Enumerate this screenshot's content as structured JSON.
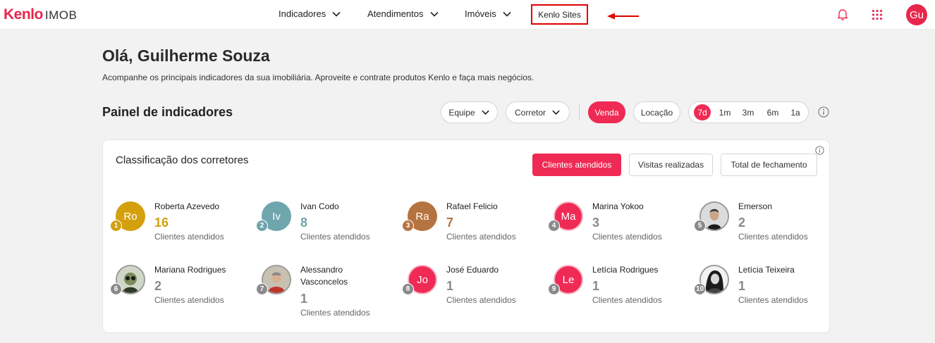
{
  "header": {
    "logo_brand": "Kenlo",
    "logo_product": "IMOB",
    "nav": [
      {
        "label": "Indicadores"
      },
      {
        "label": "Atendimentos"
      },
      {
        "label": "Imóveis"
      },
      {
        "label": "Kenlo Sites"
      }
    ],
    "user_initials": "Gu",
    "icons": [
      "bell-icon",
      "apps-grid-icon"
    ]
  },
  "greeting": "Olá, Guilherme Souza",
  "subtitle": "Acompanhe os principais indicadores da sua imobiliária. Aproveite e contrate produtos Kenlo e faça mais negócios.",
  "panel": {
    "title": "Painel de indicadores",
    "filters": {
      "team": "Equipe",
      "broker": "Corretor"
    },
    "deal_types": [
      "Venda",
      "Locação"
    ],
    "deal_type_selected": "Venda",
    "periods": [
      "7d",
      "1m",
      "3m",
      "6m",
      "1a"
    ],
    "period_selected": "7d"
  },
  "ranking": {
    "title": "Classificação dos corretores",
    "tabs": [
      "Clientes atendidos",
      "Visitas realizadas",
      "Total de fechamento"
    ],
    "tab_selected": "Clientes atendidos",
    "metric_label": "Clientes atendidos",
    "brokers": [
      {
        "rank": "1",
        "name": "Roberta Azevedo",
        "initials": "Ro",
        "count": "16",
        "color": "#d4a00e"
      },
      {
        "rank": "2",
        "name": "Ivan Codo",
        "initials": "Iv",
        "count": "8",
        "color": "#6fa6ad"
      },
      {
        "rank": "3",
        "name": "Rafael Felicio",
        "initials": "Ra",
        "count": "7",
        "color": "#b5733f"
      },
      {
        "rank": "4",
        "name": "Marina Yokoo",
        "initials": "Ma",
        "count": "3",
        "color": "#ef2a54"
      },
      {
        "rank": "5",
        "name": "Emerson",
        "initials": "",
        "count": "2",
        "color": "#8a8a8a"
      },
      {
        "rank": "6",
        "name": "Mariana Rodrigues",
        "initials": "",
        "count": "2",
        "color": "#8a8a8a"
      },
      {
        "rank": "7",
        "name": "Alessandro Vasconcelos",
        "initials": "",
        "count": "1",
        "color": "#8a8a8a"
      },
      {
        "rank": "8",
        "name": "José Eduardo",
        "initials": "Jo",
        "count": "1",
        "color": "#ef2a54"
      },
      {
        "rank": "9",
        "name": "Letícia Rodrigues",
        "initials": "Le",
        "count": "1",
        "color": "#ef2a54"
      },
      {
        "rank": "10",
        "name": "Letícia Teixeira",
        "initials": "",
        "count": "1",
        "color": "#8a8a8a"
      }
    ]
  },
  "colors": {
    "accent": "#ef2a54",
    "rank_gray": "#8a8a8a"
  }
}
